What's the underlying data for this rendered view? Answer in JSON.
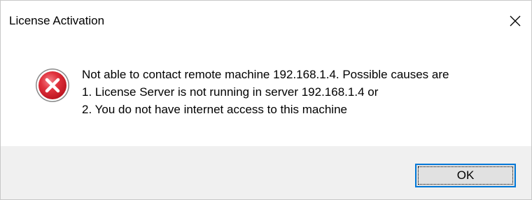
{
  "window": {
    "title": "License Activation"
  },
  "icons": {
    "close": "close-icon",
    "error": "error-icon"
  },
  "colors": {
    "error_red": "#e81123",
    "button_focus_border": "#0078d7",
    "footer_bg": "#f0f0f0"
  },
  "message": {
    "lines": [
      "Not able to contact remote machine 192.168.1.4. Possible causes are",
      "1. License Server is not running in server 192.168.1.4 or",
      "2. You do not have internet access to this machine"
    ]
  },
  "buttons": {
    "ok_label": "OK"
  }
}
